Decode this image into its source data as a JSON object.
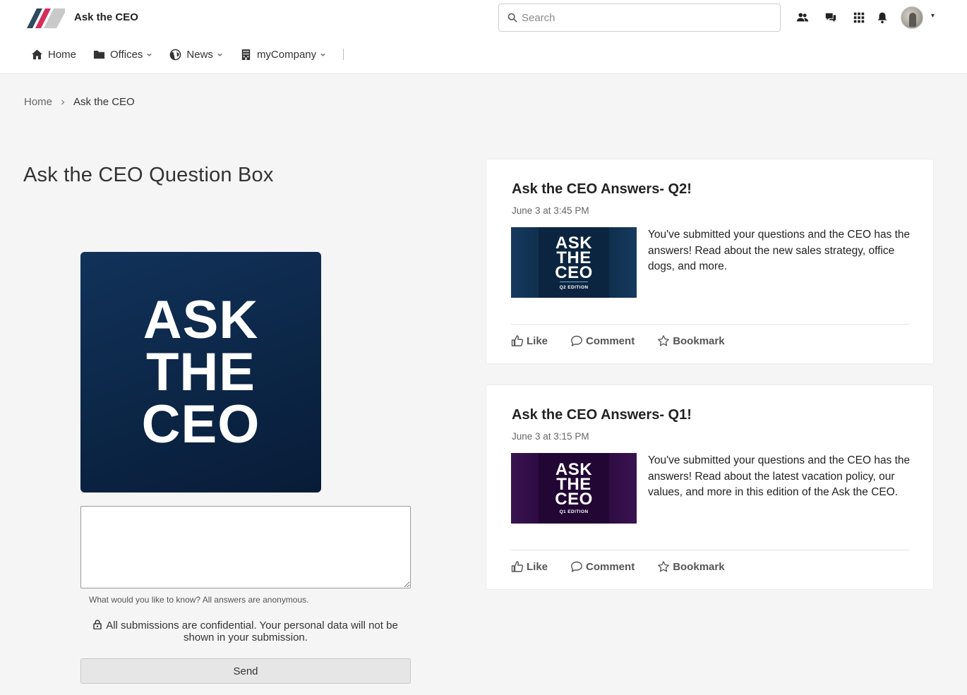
{
  "header": {
    "app_title": "Ask the CEO",
    "search_placeholder": "Search",
    "icons": [
      "people-icon",
      "chat-icon",
      "apps-grid-icon",
      "bell-icon"
    ],
    "avatar_menu_caret": "▾"
  },
  "nav": {
    "items": [
      {
        "label": "Home",
        "icon": "home-icon",
        "has_dropdown": false
      },
      {
        "label": "Offices",
        "icon": "folder-icon",
        "has_dropdown": true
      },
      {
        "label": "News",
        "icon": "globe-icon",
        "has_dropdown": true
      },
      {
        "label": "myCompany",
        "icon": "building-icon",
        "has_dropdown": true
      }
    ]
  },
  "breadcrumb": {
    "home": "Home",
    "current": "Ask the CEO"
  },
  "page": {
    "title": "Ask the CEO Question Box"
  },
  "hero": {
    "lines": [
      "ASK",
      "THE",
      "CEO"
    ],
    "background": "#0c2748"
  },
  "form": {
    "question_value": "",
    "hint": "What would you like to know? All answers are anonymous.",
    "confidential": "All submissions are confidential. Your personal data will not be shown in your submission.",
    "send_label": "Send"
  },
  "posts": [
    {
      "title": "Ask the CEO Answers- Q2!",
      "date": "June 3 at 3:45 PM",
      "thumb_lines": [
        "ASK",
        "THE",
        "CEO"
      ],
      "thumb_edition": "Q2 EDITION",
      "thumb_color": "#0d2844",
      "body": "You've submitted your questions and the CEO has the answers! Read about the new sales strategy, office dogs, and more.",
      "actions": {
        "like": "Like",
        "comment": "Comment",
        "bookmark": "Bookmark"
      }
    },
    {
      "title": "Ask the CEO Answers- Q1!",
      "date": "June 3 at 3:15 PM",
      "thumb_lines": [
        "ASK",
        "THE",
        "CEO"
      ],
      "thumb_edition": "Q1 EDITION",
      "thumb_color": "#260838",
      "body": "You've submitted your questions and the CEO has the answers! Read about the latest vacation policy, our values, and more in this edition of the Ask the CEO.",
      "actions": {
        "like": "Like",
        "comment": "Comment",
        "bookmark": "Bookmark"
      }
    }
  ]
}
